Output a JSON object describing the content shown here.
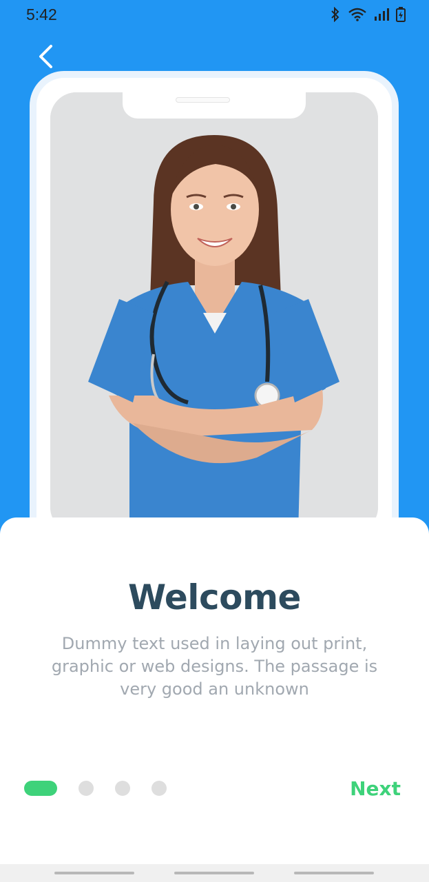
{
  "status_bar": {
    "time": "5:42",
    "icons": [
      "bluetooth-icon",
      "wifi-icon",
      "signal-icon",
      "battery-icon"
    ]
  },
  "header": {
    "back_icon": "chevron-left-icon"
  },
  "onboarding": {
    "title": "Welcome",
    "description": "Dummy text used in laying out print, graphic or web designs. The passage is very good an unknown",
    "page_count": 4,
    "active_page": 1,
    "next_label": "Next"
  },
  "colors": {
    "primary": "#2196f3",
    "accent": "#3ed27a",
    "title": "#2d4b5e",
    "body": "#a1a8b0"
  }
}
